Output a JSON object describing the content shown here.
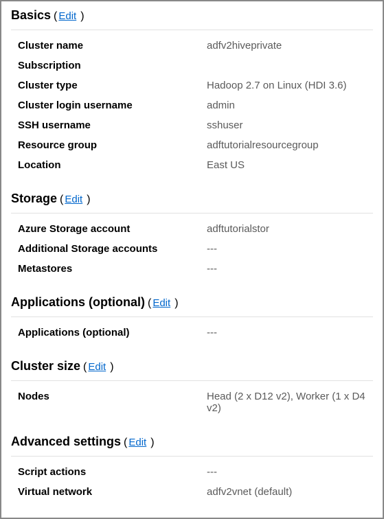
{
  "edit_label": "Edit",
  "sections": {
    "basics": {
      "title": "Basics",
      "rows": [
        {
          "label": "Cluster name",
          "value": "adfv2hiveprivate"
        },
        {
          "label": "Subscription",
          "value": ""
        },
        {
          "label": "Cluster type",
          "value": "Hadoop 2.7 on Linux (HDI 3.6)"
        },
        {
          "label": "Cluster login username",
          "value": "admin"
        },
        {
          "label": "SSH username",
          "value": "sshuser"
        },
        {
          "label": "Resource group",
          "value": "adftutorialresourcegroup"
        },
        {
          "label": "Location",
          "value": "East US"
        }
      ]
    },
    "storage": {
      "title": "Storage",
      "rows": [
        {
          "label": "Azure Storage account",
          "value": "adftutorialstor"
        },
        {
          "label": "Additional Storage accounts",
          "value": "---"
        },
        {
          "label": "Metastores",
          "value": "---"
        }
      ]
    },
    "applications": {
      "title": "Applications (optional)",
      "rows": [
        {
          "label": "Applications (optional)",
          "value": "---"
        }
      ]
    },
    "clustersize": {
      "title": "Cluster size",
      "rows": [
        {
          "label": "Nodes",
          "value": "Head (2 x D12 v2), Worker (1 x D4 v2)"
        }
      ]
    },
    "advanced": {
      "title": "Advanced settings",
      "rows": [
        {
          "label": "Script actions",
          "value": "---"
        },
        {
          "label": "Virtual network",
          "value": "adfv2vnet (default)"
        }
      ]
    }
  }
}
